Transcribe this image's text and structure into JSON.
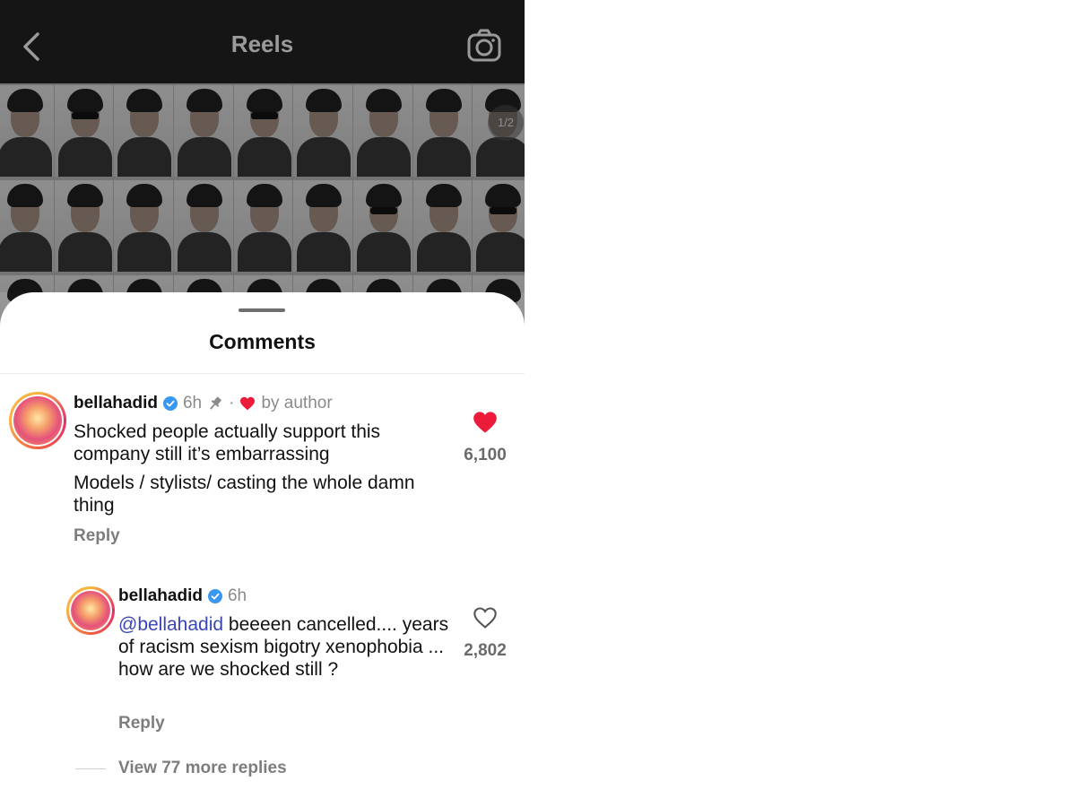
{
  "header": {
    "title": "Reels",
    "back_icon": "chevron-left-icon",
    "camera_icon": "camera-icon"
  },
  "reel": {
    "page_indicator": "1/2"
  },
  "sheet": {
    "title": "Comments"
  },
  "comments": [
    {
      "username": "bellahadid",
      "time": "6h",
      "separator": "·",
      "liked_by_author": "by author",
      "text_paragraphs": [
        "Shocked people actually support this company still it’s embarrassing",
        "Models / stylists/ casting the whole damn thing"
      ],
      "likes": "6,100",
      "liked": true,
      "reply_label": "Reply"
    },
    {
      "username": "bellahadid",
      "time": "6h",
      "mention": "@bellahadid",
      "text": " beeeen cancelled.... years of racism sexism bigotry xenophobia ... how are we shocked still ?",
      "likes": "2,802",
      "liked": false,
      "reply_label": "Reply"
    }
  ],
  "view_more_replies": "View 77 more replies",
  "colors": {
    "like_red": "#ed1b3a",
    "verified_blue": "#3897f0",
    "mention_blue": "#3a46b8"
  }
}
